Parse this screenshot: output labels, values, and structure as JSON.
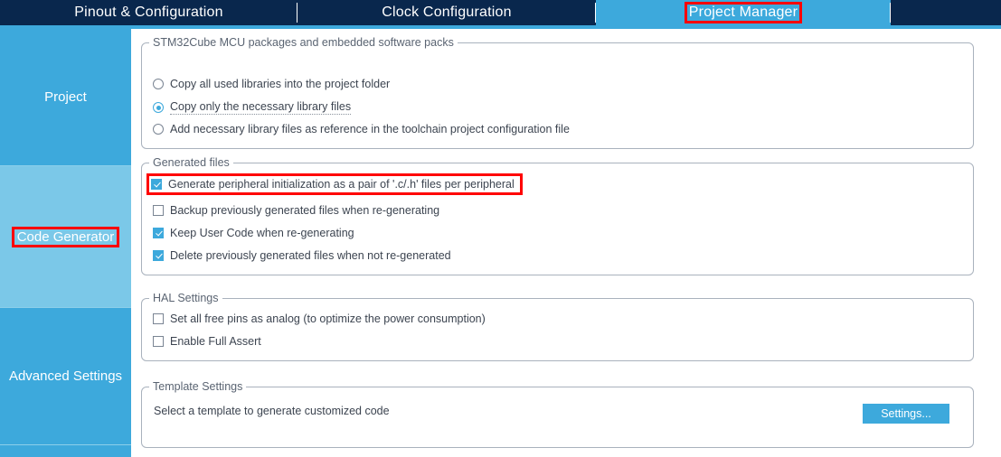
{
  "colors": {
    "tab_bar_dark": "#09274d",
    "accent_blue": "#3da9dc",
    "sidebar_selected": "#7bc8e8",
    "annotation_red": "#ff0000",
    "groupbox_border": "#a9b2bd",
    "text": "#3c4450"
  },
  "tabs": [
    {
      "label": "Pinout & Configuration",
      "active": false
    },
    {
      "label": "Clock Configuration",
      "active": false
    },
    {
      "label": "Project Manager",
      "active": true
    }
  ],
  "sidebar": {
    "items": [
      {
        "label": "Project",
        "selected": false,
        "annotated": false
      },
      {
        "label": "Code Generator",
        "selected": true,
        "annotated": true
      },
      {
        "label": "Advanced Settings",
        "selected": false,
        "annotated": false
      },
      {
        "label": "",
        "selected": false,
        "annotated": false
      }
    ]
  },
  "groups": {
    "packages": {
      "title": "STM32Cube MCU packages and embedded software packs",
      "options": [
        {
          "label": "Copy all used libraries into the project folder",
          "checked": false,
          "focused": false
        },
        {
          "label": "Copy only the necessary library files",
          "checked": true,
          "focused": true
        },
        {
          "label": "Add necessary library files as reference in the toolchain project configuration file",
          "checked": false,
          "focused": false
        }
      ]
    },
    "generated_files": {
      "title": "Generated files",
      "options": [
        {
          "label": "Generate peripheral initialization as a pair of '.c/.h' files per peripheral",
          "checked": true,
          "annotated": true
        },
        {
          "label": "Backup previously generated files when re-generating",
          "checked": false,
          "annotated": false
        },
        {
          "label": "Keep User Code when re-generating",
          "checked": true,
          "annotated": false
        },
        {
          "label": "Delete previously generated files when not re-generated",
          "checked": true,
          "annotated": false
        }
      ]
    },
    "hal_settings": {
      "title": "HAL Settings",
      "options": [
        {
          "label": "Set all free pins as analog (to optimize the power consumption)",
          "checked": false
        },
        {
          "label": "Enable Full Assert",
          "checked": false
        }
      ]
    },
    "template_settings": {
      "title": "Template Settings",
      "description": "Select a template to generate customized code",
      "settings_button": "Settings..."
    }
  }
}
